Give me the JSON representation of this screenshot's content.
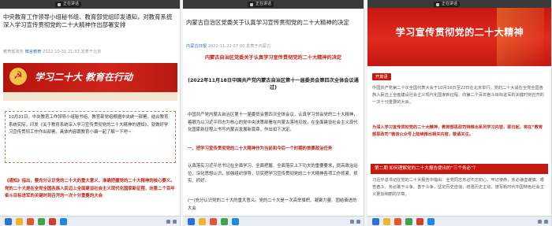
{
  "share_bar_label": "正在讲话",
  "panels": [
    {
      "title": "中央教育工作领导小组秘书组、教育部党组印发通知，对教育系统深入学习宣传贯彻党的二十大精神作出部署安排",
      "source": "教育部政务",
      "author": "微言教育",
      "date": "2022-10-31 21:33",
      "published": "发表于北京",
      "banner_text": "学习二十大 教育在行动",
      "box_text": "10月31日，中央教育工作领导小组秘书组、教育部党组根据中央统一部署，结合教育系统实际，印发《关于教育系统深入学习宣传贯彻党的二十大精神的通知》，就做好学习宣传贯彻工作作出部署。具体内容跟教育小编一起了解一下吧~",
      "red_note": "《通知》指出，要充分认识党的二十大的重大意义，准确把握党的二十大精神的核心要义。党的二十大是在全党全国各族人民迈上全面建设社会主义现代化国家新征程，向第二个百年奋斗目标进军的关键时刻召开的一次十分重要的大会"
    },
    {
      "title": "内蒙古自治区党委关于认真学习宣传贯彻党的二十大精神的决定",
      "source": "内蒙古日报",
      "date": "2022-11-22 07:00",
      "published": "发表于内蒙古",
      "red_heading": "内蒙古自治区党委关于认真学习宣传贯彻党的二十大精神的决定",
      "sub_heading": "(2022年11月18日中国共产党内蒙古自治区第十一届委员会第四次全体会议通过)",
      "paragraph1": "中国共产党内蒙古自治区第十一届委员会第四次全体会议，认真学习领会党的二十大精神，着眼为以习近平同志为核心的党中央决策部署在内蒙古落地见效，在全面建设社会主义现代化国家新征程上书写内蒙古发展新篇章，作出如下决定。",
      "section1": "一、把学习宣传贯彻党的二十大精神作为当前和今后一个时期的首要政治任务",
      "paragraph2": "认真落实习近平总书记在全面学习、全面把握、全面落实上下功夫的重要要求，提高政治站位，深化思想认识，加强组织领导，切实把学习宣传贯彻党的二十大精神各项工作抓紧、抓实、抓好。",
      "paragraph3": "(一)充分认识党的二十大的重大意义。党的二十大是一次高举旗帜、凝聚力量、团结奋进的大会"
    },
    {
      "banner_text": "学习宣传贯彻党的二十大精神",
      "tag": "开篇语",
      "paragraph1": "中国共产党第二十次全国代表大会于10月16日至22日在北京举行。党的二十大是在全党全国各族人民迈上全面建设社会主义现代化国家新征程、向第二个百年奋斗目标进军的关键时刻召开的一次十分重要的大会。",
      "red_paragraph": "为深入学习宣传贯彻党的二十大精神，教育部思政司特推出系列学习内容，即日起，将在“教育部思政司”微信公众号上陆续推出相关内容，敬请关注。",
      "section_bar": "第二期 如何理解党的二十大报告提出的“三个务必”？",
      "paragraph2": "习近平总书记在党的二十大报告中指出：全党同志务必不忘初心、牢记使命，务必谦虚谨慎、艰苦奋斗，务必敢于斗争、善于斗争，坚定历史自信，增强历史主动，谱写新时代中国特色社会主义更加绚丽的华章。"
    }
  ],
  "colors": {
    "brand_red": "#c8170f",
    "link_blue": "#2e6fb8"
  }
}
